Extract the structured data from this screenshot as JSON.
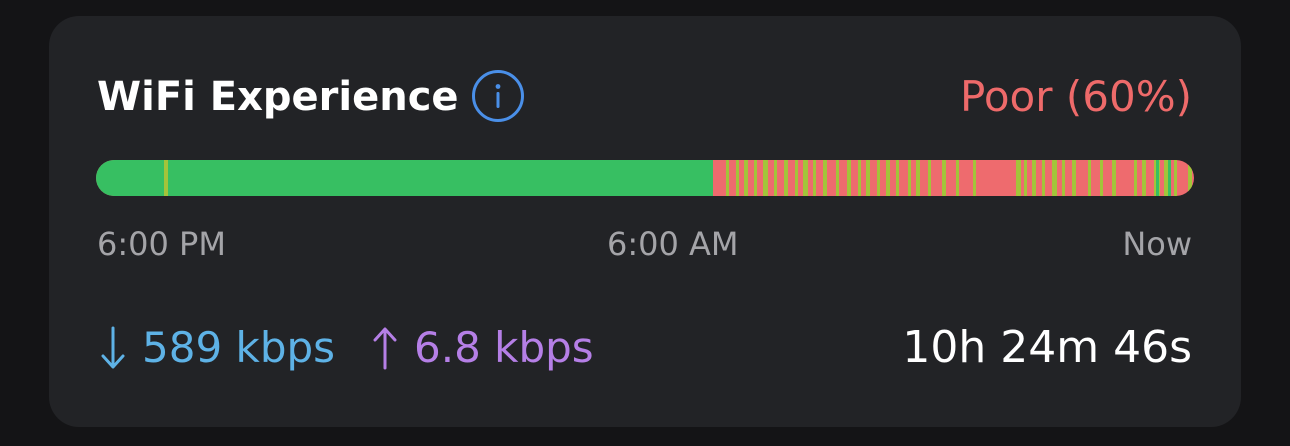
{
  "card": {
    "title": "WiFi Experience",
    "info_icon": "info-circle-icon",
    "quality_label": "Poor (60%)",
    "quality_color": "#ee6a6a"
  },
  "timeline": {
    "colors": {
      "good": "#37bf62",
      "fair": "#a3c43a",
      "poor": "#ee6b6e"
    },
    "axis_labels": {
      "start": "6:00 PM",
      "middle": "6:00 AM",
      "end": "Now"
    }
  },
  "stats": {
    "download": {
      "icon": "arrow-down-icon",
      "value": "589 kbps",
      "color": "#5eb2e6"
    },
    "upload": {
      "icon": "arrow-up-icon",
      "value": "6.8 kbps",
      "color": "#b57fe6"
    },
    "duration": "10h 24m 46s"
  }
}
